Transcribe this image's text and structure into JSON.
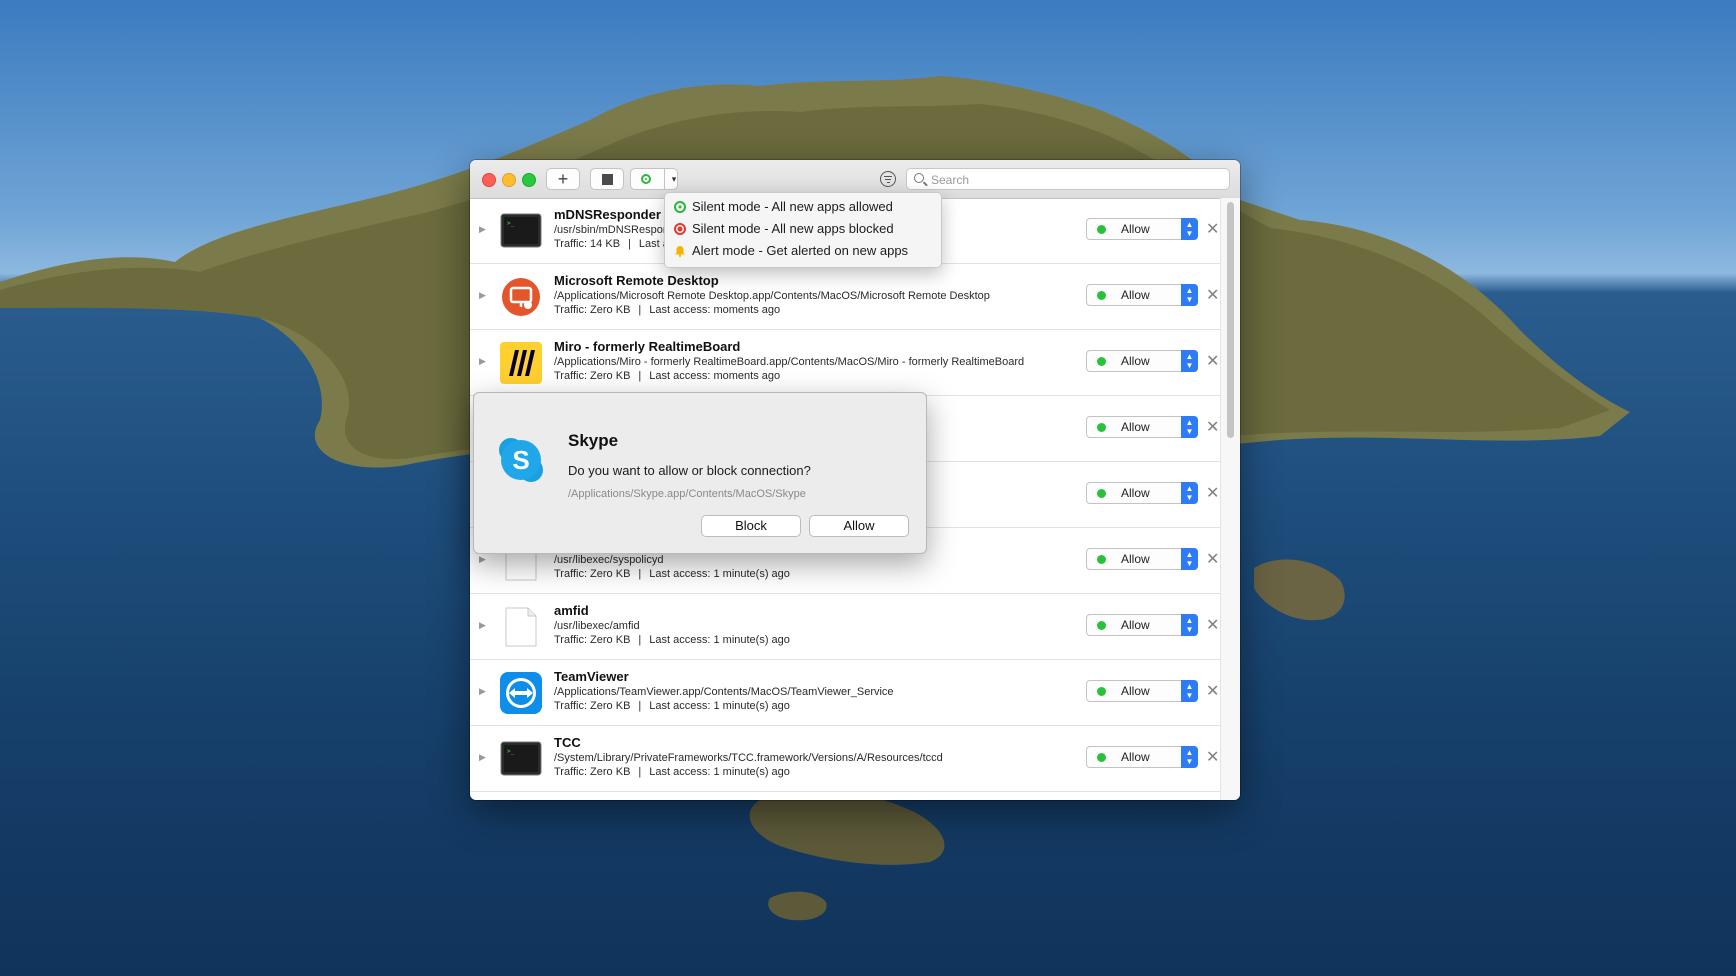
{
  "window": {
    "search": {
      "placeholder": "Search"
    },
    "toolbar": {
      "add_label": "+"
    }
  },
  "mode_menu": {
    "items": [
      {
        "label": "Silent mode - All new apps allowed",
        "icon": "green-circle-icon",
        "color": "#29b83a"
      },
      {
        "label": "Silent mode - All new apps blocked",
        "icon": "red-circle-icon",
        "color": "#e23b2e"
      },
      {
        "label": "Alert mode - Get alerted on new apps",
        "icon": "bell-icon",
        "color": "#f4b400"
      }
    ]
  },
  "apps": [
    {
      "name": "mDNSResponder",
      "path": "/usr/sbin/mDNSResponder",
      "traffic": "Traffic: 14 KB",
      "last_access": "Last access: moments ago",
      "rule": "Allow",
      "icon": "terminal-icon"
    },
    {
      "name": "Microsoft Remote Desktop",
      "path": "/Applications/Microsoft Remote Desktop.app/Contents/MacOS/Microsoft Remote Desktop",
      "traffic": "Traffic: Zero KB",
      "last_access": "Last access: moments ago",
      "rule": "Allow",
      "icon": "remote-desktop-icon"
    },
    {
      "name": "Miro - formerly RealtimeBoard",
      "path": "/Applications/Miro - formerly RealtimeBoard.app/Contents/MacOS/Miro - formerly RealtimeBoard",
      "traffic": "Traffic: Zero KB",
      "last_access": "Last access: moments ago",
      "rule": "Allow",
      "icon": "miro-icon"
    },
    {
      "name": "",
      "path": "",
      "traffic": "",
      "last_access": "",
      "rule": "Allow",
      "icon": ""
    },
    {
      "name": "",
      "path": "",
      "traffic": "",
      "last_access": "",
      "rule": "Allow",
      "icon": ""
    },
    {
      "name": "",
      "path": "/usr/libexec/syspolicyd",
      "traffic": "Traffic: Zero KB",
      "last_access": "Last access: 1 minute(s) ago",
      "rule": "Allow",
      "icon": "document-icon"
    },
    {
      "name": "amfid",
      "path": "/usr/libexec/amfid",
      "traffic": "Traffic: Zero KB",
      "last_access": "Last access: 1 minute(s) ago",
      "rule": "Allow",
      "icon": "document-icon"
    },
    {
      "name": "TeamViewer",
      "path": "/Applications/TeamViewer.app/Contents/MacOS/TeamViewer_Service",
      "traffic": "Traffic: Zero KB",
      "last_access": "Last access: 1 minute(s) ago",
      "rule": "Allow",
      "icon": "teamviewer-icon"
    },
    {
      "name": "TCC",
      "path": "/System/Library/PrivateFrameworks/TCC.framework/Versions/A/Resources/tccd",
      "traffic": "Traffic: Zero KB",
      "last_access": "Last access: 1 minute(s) ago",
      "rule": "Allow",
      "icon": "terminal-icon"
    }
  ],
  "alert": {
    "app_name": "Skype",
    "message": "Do you want to allow or block connection?",
    "path": "/Applications/Skype.app/Contents/MacOS/Skype",
    "block_label": "Block",
    "allow_label": "Allow"
  },
  "colors": {
    "accent": "#2d7cf6",
    "allow_green": "#27c23a"
  }
}
